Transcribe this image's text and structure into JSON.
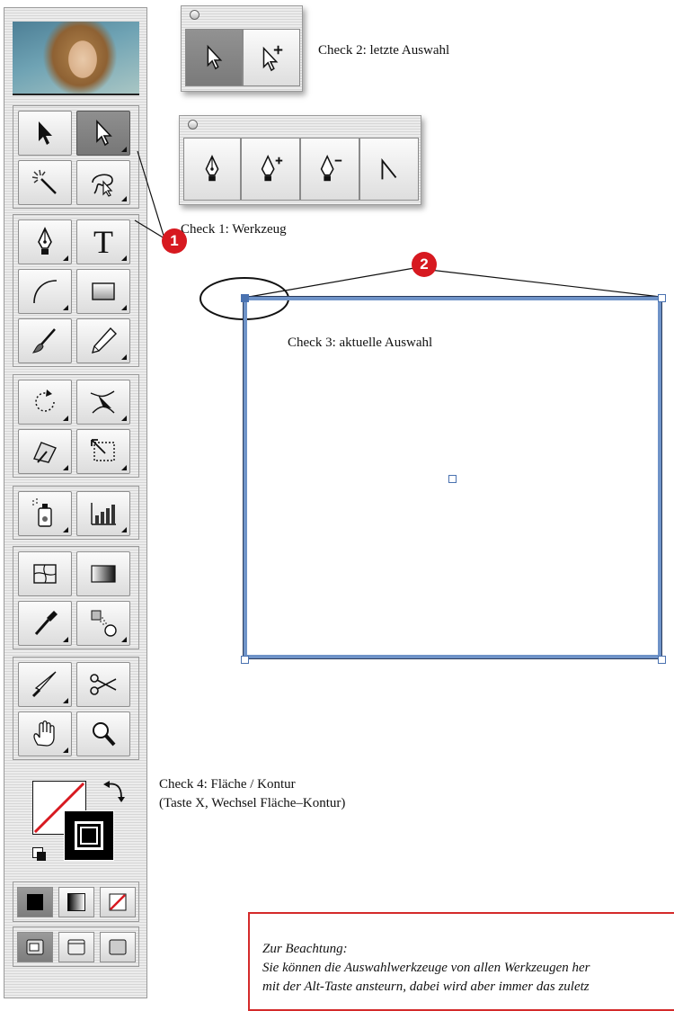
{
  "labels": {
    "check1": "Check 1: Werkzeug",
    "check2": "Check 2: letzte Auswahl",
    "check3": "Check 3: aktuelle Auswahl",
    "check4_line1": "Check 4: Fläche / Kontur",
    "check4_line2": "(Taste X, Wechsel Fläche–Kontur)"
  },
  "callouts": {
    "one": "1",
    "two": "2"
  },
  "toolbox": {
    "tools": [
      "selection-tool",
      "direct-selection-tool",
      "magic-wand-tool",
      "lasso-tool",
      "pen-tool",
      "type-tool",
      "arc-tool",
      "rectangle-tool",
      "paintbrush-tool",
      "pencil-tool",
      "rotate-tool",
      "warp-tool",
      "free-transform-tool",
      "scale-tool",
      "symbol-sprayer-tool",
      "graph-tool",
      "mesh-tool",
      "gradient-tool",
      "eyedropper-tool",
      "blend-tool",
      "knife-tool",
      "scissors-tool",
      "hand-tool",
      "zoom-tool"
    ],
    "type_tool_glyph": "T"
  },
  "palettes": {
    "selection": [
      "direct-selection-tool",
      "group-selection-tool"
    ],
    "pen": [
      "pen-tool",
      "add-anchor-point-tool",
      "delete-anchor-point-tool",
      "convert-anchor-point-tool"
    ]
  },
  "colors": {
    "accent_red": "#d71920",
    "selection_blue": "#6f93c8",
    "note_border": "#d42a2a"
  },
  "note": {
    "heading": "Zur Beachtung:",
    "line1": "Sie können die Auswahlwerkzeuge von allen Werkzeugen her",
    "line2": "mit der Alt-Taste ansteurn, dabei wird aber immer das zuletz"
  }
}
